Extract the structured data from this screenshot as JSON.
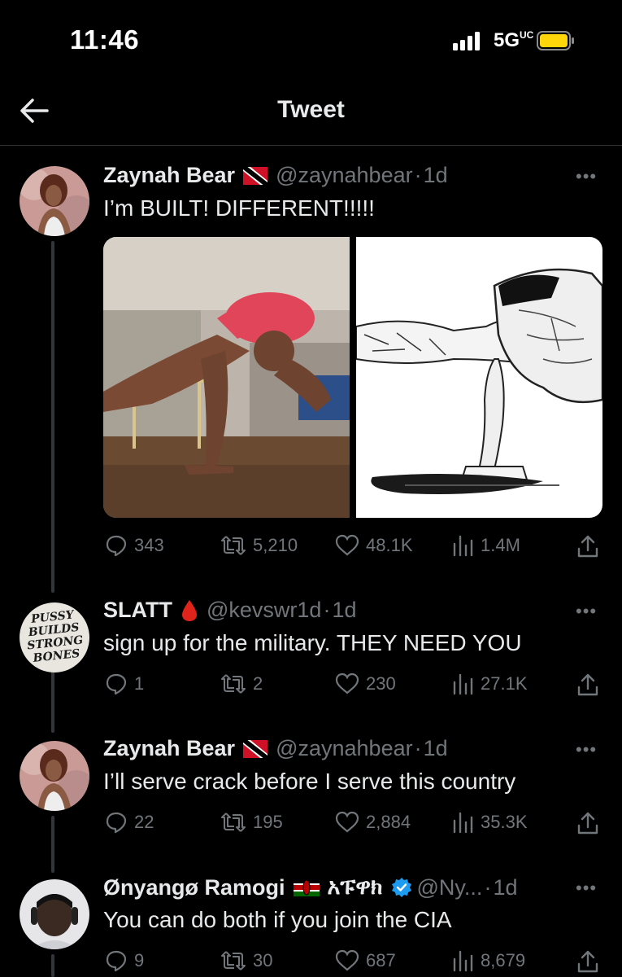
{
  "status_bar": {
    "time": "11:46",
    "network": "5G",
    "network_super": "UC"
  },
  "header": {
    "title": "Tweet"
  },
  "tweets": [
    {
      "name": "Zaynah Bear",
      "flag": "trinidad-tobago-flag",
      "handle": "@zaynahbear",
      "time": "1d",
      "text": "I’m BUILT! DIFFERENT!!!!!",
      "replies": "343",
      "retweets": "5,210",
      "likes": "48.1K",
      "views": "1.4M"
    },
    {
      "name": "SLATT",
      "emoji": "blood-drop-emoji",
      "handle": "@kevswr1d",
      "time": "1d",
      "text": "sign up for the military. THEY NEED YOU",
      "avatar_text": [
        "PUSSY",
        "BUILDS",
        "STRONG",
        "BONES"
      ],
      "replies": "1",
      "retweets": "2",
      "likes": "230",
      "views": "27.1K"
    },
    {
      "name": "Zaynah Bear",
      "flag": "trinidad-tobago-flag",
      "handle": "@zaynahbear",
      "time": "1d",
      "text": "I’ll serve crack before I serve this country",
      "replies": "22",
      "retweets": "195",
      "likes": "2,884",
      "views": "35.3K"
    },
    {
      "name": "Ønyangø Ramogi",
      "flag": "kenya-flag",
      "name_suffix": "አፑዋክ",
      "verified": true,
      "handle": "@Ny...",
      "time": "1d",
      "text": "You can do both if you join the CIA",
      "replies": "9",
      "retweets": "30",
      "likes": "687",
      "views": "8,679"
    }
  ],
  "separator": "·",
  "more_label": "•••",
  "colors": {
    "background": "#000000",
    "text": "#e7e9ea",
    "muted": "#71767b",
    "verified": "#1d9bf0",
    "blood": "#e0241b"
  }
}
